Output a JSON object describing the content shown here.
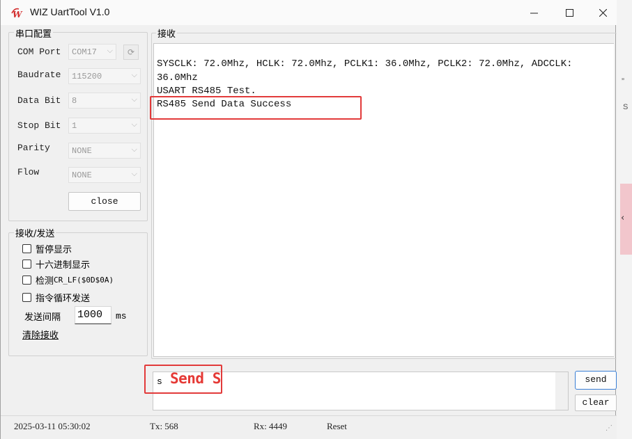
{
  "window": {
    "title": "WIZ UartTool V1.0"
  },
  "serial_config": {
    "group_title": "串口配置",
    "com_port": {
      "label": "COM Port",
      "value": "COM17"
    },
    "baudrate": {
      "label": "Baudrate",
      "value": "115200"
    },
    "data_bit": {
      "label": "Data Bit",
      "value": "8"
    },
    "stop_bit": {
      "label": "Stop Bit",
      "value": "1"
    },
    "parity": {
      "label": "Parity",
      "value": "NONE"
    },
    "flow": {
      "label": "Flow",
      "value": "NONE"
    },
    "close_label": "close"
  },
  "recv_send": {
    "group_title": "接收/发送",
    "pause_display": "暂停显示",
    "hex_display": "十六进制显示",
    "detect_prefix": "检测",
    "detect_suffix": "CR_LF($0D$0A)",
    "cmd_loop": "指令循环发送",
    "interval_label": "发送间隔",
    "interval_value": "1000",
    "interval_unit": "ms",
    "clear_recv": "清除接收"
  },
  "receive": {
    "group_title": "接收",
    "lines": [
      "SYSCLK: 72.0Mhz, HCLK: 72.0Mhz, PCLK1: 36.0Mhz, PCLK2: 72.0Mhz, ADCCLK:",
      "36.0Mhz",
      "USART RS485 Test.",
      "RS485 Send Data Success"
    ]
  },
  "send": {
    "text": "s",
    "annotation": "Send S",
    "send_label": "send",
    "clear_label": "clear"
  },
  "status": {
    "datetime": "2025-03-11 05:30:02",
    "tx": "Tx: 568",
    "rx": "Rx: 4449",
    "reset": "Reset"
  },
  "colors": {
    "highlight": "#e23a3a",
    "annotation": "#e53935",
    "logo": "#d32f2f"
  }
}
